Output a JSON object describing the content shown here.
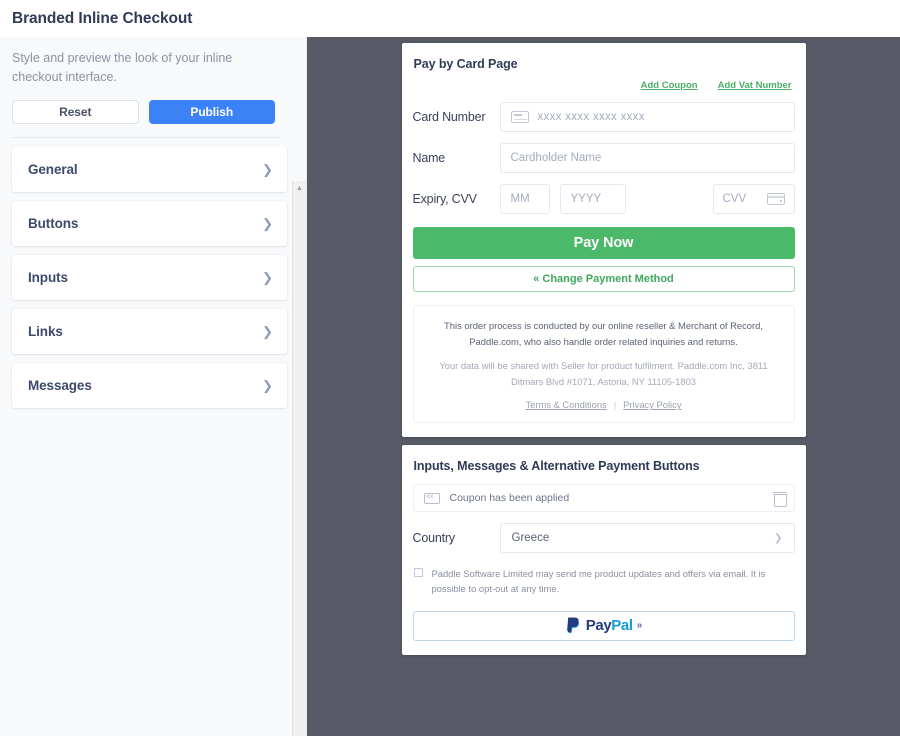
{
  "window": {
    "title": "Branded Inline Checkout"
  },
  "sidebar": {
    "description": "Style and preview the look of your inline checkout interface.",
    "reset_label": "Reset",
    "publish_label": "Publish",
    "accent_blue": "#3b82f6",
    "items": [
      {
        "label": "General"
      },
      {
        "label": "Buttons"
      },
      {
        "label": "Inputs"
      },
      {
        "label": "Links"
      },
      {
        "label": "Messages"
      }
    ]
  },
  "preview": {
    "background": "#585b67",
    "pay_card": {
      "title": "Pay by Card Page",
      "links": [
        {
          "label": "Add Coupon"
        },
        {
          "label": "Add Vat Number"
        }
      ],
      "link_color": "#4caf68",
      "fields": {
        "card_number_label": "Card Number",
        "card_number_placeholder": "xxxx xxxx xxxx xxxx",
        "name_label": "Name",
        "name_placeholder": "Cardholder Name",
        "expiry_label": "Expiry, CVV",
        "month_placeholder": "MM",
        "year_placeholder": "YYYY",
        "cvv_placeholder": "CVV"
      },
      "pay_now_label": "Pay Now",
      "pay_now_color": "#4cb86a",
      "change_payment_label": "« Change Payment Method",
      "legal": {
        "line1": "This order process is conducted by our online reseller & Merchant of Record, Paddle.com, who also handle order related inquiries and returns.",
        "line2": "Your data will be shared with Seller for product fulfilment. Paddle.com Inc, 3811 Ditmars Blvd #1071, Astoria, NY 11105-1803",
        "terms_label": "Terms & Conditions",
        "separator": "|",
        "privacy_label": "Privacy Policy"
      }
    },
    "inputs_card": {
      "title": "Inputs, Messages & Alternative Payment Buttons",
      "coupon_text": "Coupon has been applied",
      "country_label": "Country",
      "country_value": "Greece",
      "optin_text": "Paddle Software Limited may send me product updates and offers via email. It is possible to opt-out at any time.",
      "paypal": {
        "pay": "Pay",
        "pal": "Pal",
        "chevron": "»"
      }
    }
  }
}
